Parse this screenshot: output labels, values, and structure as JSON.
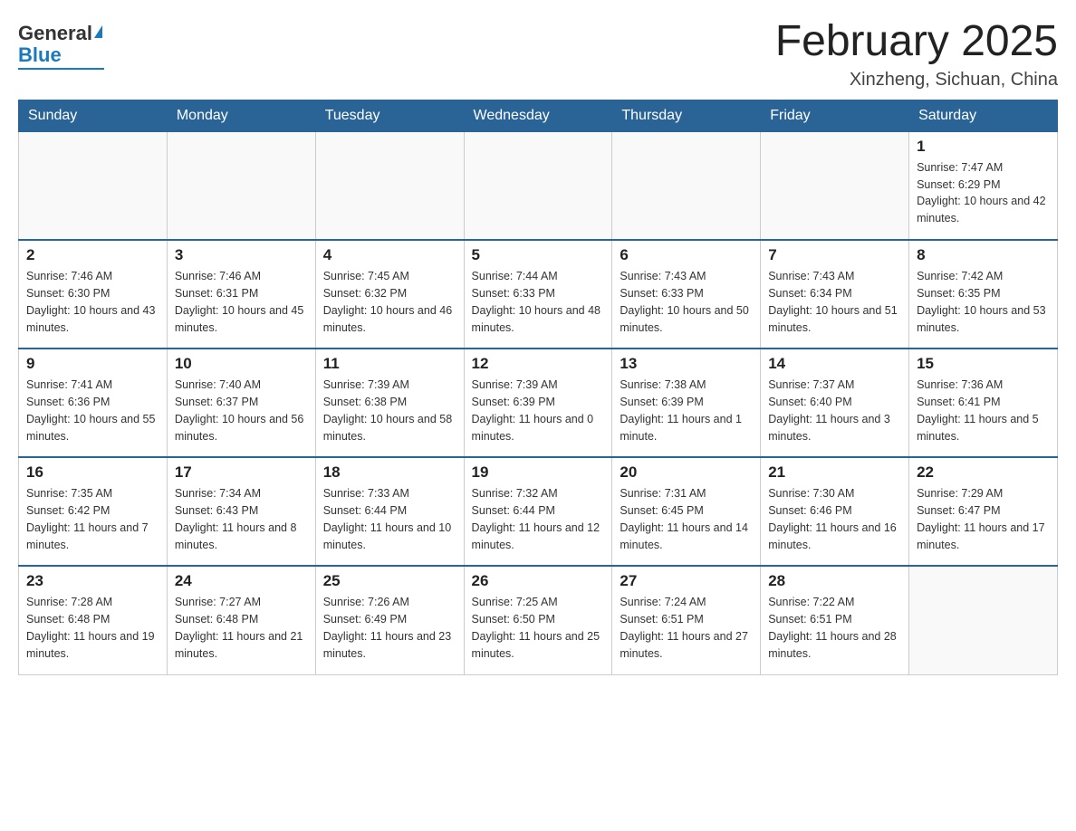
{
  "header": {
    "logo_general": "General",
    "logo_blue": "Blue",
    "month_title": "February 2025",
    "location": "Xinzheng, Sichuan, China"
  },
  "days_of_week": [
    "Sunday",
    "Monday",
    "Tuesday",
    "Wednesday",
    "Thursday",
    "Friday",
    "Saturday"
  ],
  "weeks": [
    {
      "days": [
        {
          "date": "",
          "info": ""
        },
        {
          "date": "",
          "info": ""
        },
        {
          "date": "",
          "info": ""
        },
        {
          "date": "",
          "info": ""
        },
        {
          "date": "",
          "info": ""
        },
        {
          "date": "",
          "info": ""
        },
        {
          "date": "1",
          "info": "Sunrise: 7:47 AM\nSunset: 6:29 PM\nDaylight: 10 hours and 42 minutes."
        }
      ]
    },
    {
      "days": [
        {
          "date": "2",
          "info": "Sunrise: 7:46 AM\nSunset: 6:30 PM\nDaylight: 10 hours and 43 minutes."
        },
        {
          "date": "3",
          "info": "Sunrise: 7:46 AM\nSunset: 6:31 PM\nDaylight: 10 hours and 45 minutes."
        },
        {
          "date": "4",
          "info": "Sunrise: 7:45 AM\nSunset: 6:32 PM\nDaylight: 10 hours and 46 minutes."
        },
        {
          "date": "5",
          "info": "Sunrise: 7:44 AM\nSunset: 6:33 PM\nDaylight: 10 hours and 48 minutes."
        },
        {
          "date": "6",
          "info": "Sunrise: 7:43 AM\nSunset: 6:33 PM\nDaylight: 10 hours and 50 minutes."
        },
        {
          "date": "7",
          "info": "Sunrise: 7:43 AM\nSunset: 6:34 PM\nDaylight: 10 hours and 51 minutes."
        },
        {
          "date": "8",
          "info": "Sunrise: 7:42 AM\nSunset: 6:35 PM\nDaylight: 10 hours and 53 minutes."
        }
      ]
    },
    {
      "days": [
        {
          "date": "9",
          "info": "Sunrise: 7:41 AM\nSunset: 6:36 PM\nDaylight: 10 hours and 55 minutes."
        },
        {
          "date": "10",
          "info": "Sunrise: 7:40 AM\nSunset: 6:37 PM\nDaylight: 10 hours and 56 minutes."
        },
        {
          "date": "11",
          "info": "Sunrise: 7:39 AM\nSunset: 6:38 PM\nDaylight: 10 hours and 58 minutes."
        },
        {
          "date": "12",
          "info": "Sunrise: 7:39 AM\nSunset: 6:39 PM\nDaylight: 11 hours and 0 minutes."
        },
        {
          "date": "13",
          "info": "Sunrise: 7:38 AM\nSunset: 6:39 PM\nDaylight: 11 hours and 1 minute."
        },
        {
          "date": "14",
          "info": "Sunrise: 7:37 AM\nSunset: 6:40 PM\nDaylight: 11 hours and 3 minutes."
        },
        {
          "date": "15",
          "info": "Sunrise: 7:36 AM\nSunset: 6:41 PM\nDaylight: 11 hours and 5 minutes."
        }
      ]
    },
    {
      "days": [
        {
          "date": "16",
          "info": "Sunrise: 7:35 AM\nSunset: 6:42 PM\nDaylight: 11 hours and 7 minutes."
        },
        {
          "date": "17",
          "info": "Sunrise: 7:34 AM\nSunset: 6:43 PM\nDaylight: 11 hours and 8 minutes."
        },
        {
          "date": "18",
          "info": "Sunrise: 7:33 AM\nSunset: 6:44 PM\nDaylight: 11 hours and 10 minutes."
        },
        {
          "date": "19",
          "info": "Sunrise: 7:32 AM\nSunset: 6:44 PM\nDaylight: 11 hours and 12 minutes."
        },
        {
          "date": "20",
          "info": "Sunrise: 7:31 AM\nSunset: 6:45 PM\nDaylight: 11 hours and 14 minutes."
        },
        {
          "date": "21",
          "info": "Sunrise: 7:30 AM\nSunset: 6:46 PM\nDaylight: 11 hours and 16 minutes."
        },
        {
          "date": "22",
          "info": "Sunrise: 7:29 AM\nSunset: 6:47 PM\nDaylight: 11 hours and 17 minutes."
        }
      ]
    },
    {
      "days": [
        {
          "date": "23",
          "info": "Sunrise: 7:28 AM\nSunset: 6:48 PM\nDaylight: 11 hours and 19 minutes."
        },
        {
          "date": "24",
          "info": "Sunrise: 7:27 AM\nSunset: 6:48 PM\nDaylight: 11 hours and 21 minutes."
        },
        {
          "date": "25",
          "info": "Sunrise: 7:26 AM\nSunset: 6:49 PM\nDaylight: 11 hours and 23 minutes."
        },
        {
          "date": "26",
          "info": "Sunrise: 7:25 AM\nSunset: 6:50 PM\nDaylight: 11 hours and 25 minutes."
        },
        {
          "date": "27",
          "info": "Sunrise: 7:24 AM\nSunset: 6:51 PM\nDaylight: 11 hours and 27 minutes."
        },
        {
          "date": "28",
          "info": "Sunrise: 7:22 AM\nSunset: 6:51 PM\nDaylight: 11 hours and 28 minutes."
        },
        {
          "date": "",
          "info": ""
        }
      ]
    }
  ]
}
